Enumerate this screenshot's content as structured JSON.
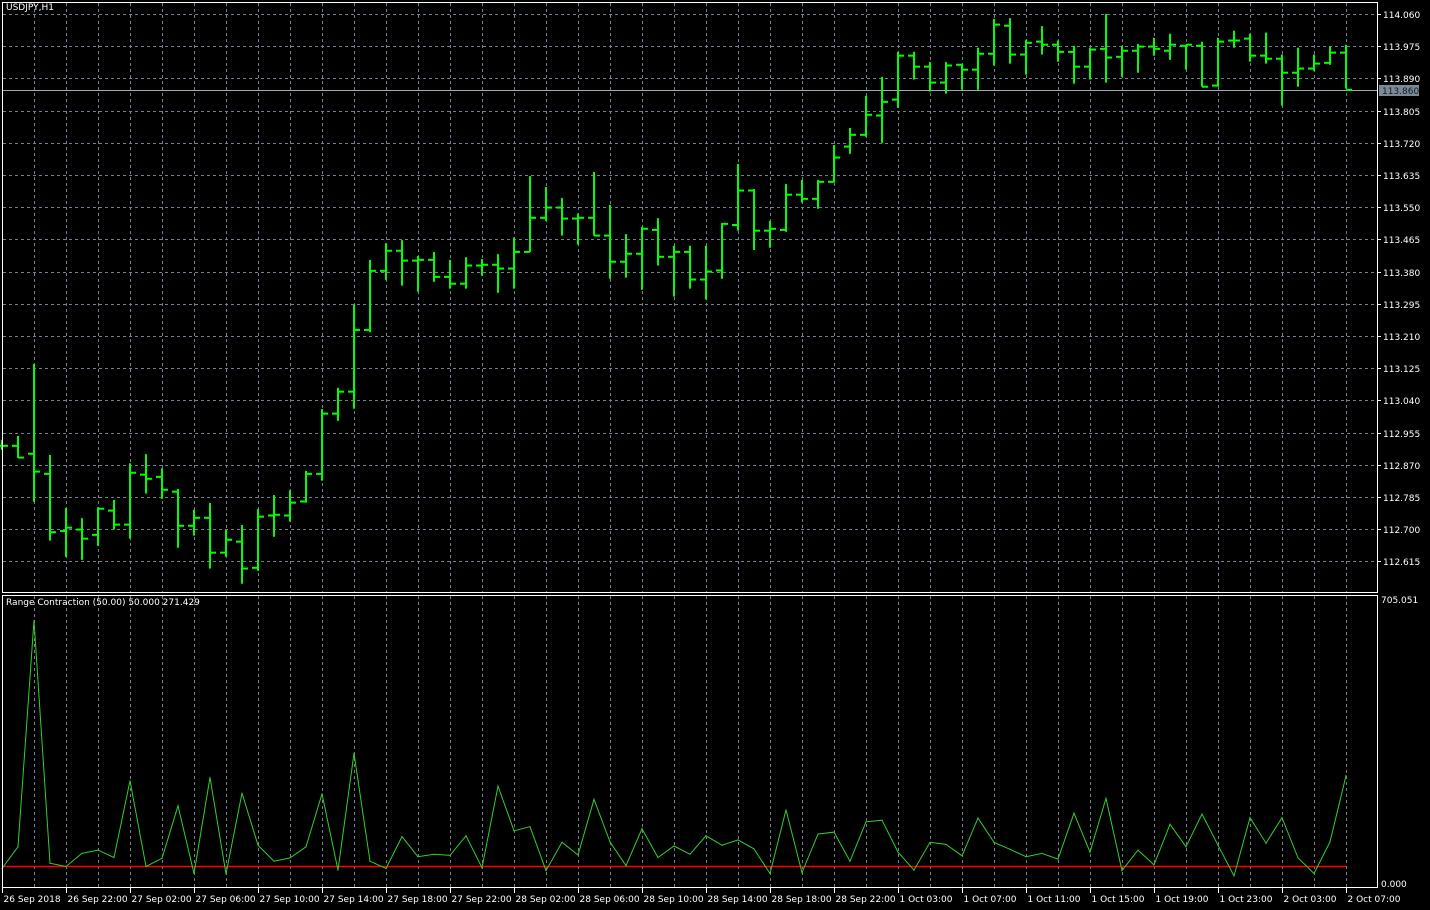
{
  "chart": {
    "title": "USDJPY,H1",
    "symbol": "USDJPY",
    "timeframe": "H1",
    "bar_color": "#00ff00",
    "grid_color": "#6f7f94",
    "current_price": "113.860",
    "price_labels": [
      "114.060",
      "113.975",
      "113.890",
      "113.805",
      "113.720",
      "113.635",
      "113.550",
      "113.465",
      "113.380",
      "113.295",
      "113.210",
      "113.125",
      "113.040",
      "112.955",
      "112.870",
      "112.785",
      "112.700",
      "112.615"
    ],
    "time_labels": [
      "26 Sep 2018",
      "26 Sep 22:00",
      "27 Sep 02:00",
      "27 Sep 06:00",
      "27 Sep 10:00",
      "27 Sep 14:00",
      "27 Sep 18:00",
      "27 Sep 22:00",
      "28 Sep 02:00",
      "28 Sep 06:00",
      "28 Sep 10:00",
      "28 Sep 14:00",
      "28 Sep 18:00",
      "28 Sep 22:00",
      "1 Oct 03:00",
      "1 Oct 07:00",
      "1 Oct 11:00",
      "1 Oct 15:00",
      "1 Oct 19:00",
      "1 Oct 23:00",
      "2 Oct 03:00",
      "2 Oct 07:00"
    ],
    "ohlc": [
      [
        112.92,
        112.935,
        112.909,
        112.92
      ],
      [
        112.92,
        112.946,
        112.888,
        112.889
      ],
      [
        112.899,
        113.136,
        112.772,
        112.852
      ],
      [
        112.846,
        112.896,
        112.67,
        112.692
      ],
      [
        112.695,
        112.756,
        112.627,
        112.704
      ],
      [
        112.699,
        112.729,
        112.619,
        112.675
      ],
      [
        112.685,
        112.758,
        112.656,
        112.754
      ],
      [
        112.749,
        112.777,
        112.699,
        112.712
      ],
      [
        112.712,
        112.874,
        112.675,
        112.849
      ],
      [
        112.844,
        112.898,
        112.794,
        112.833
      ],
      [
        112.838,
        112.861,
        112.78,
        112.804
      ],
      [
        112.799,
        112.806,
        112.651,
        112.709
      ],
      [
        112.709,
        112.751,
        112.683,
        112.73
      ],
      [
        112.73,
        112.769,
        112.596,
        112.638
      ],
      [
        112.638,
        112.698,
        112.627,
        112.672
      ],
      [
        112.667,
        112.711,
        112.556,
        112.596
      ],
      [
        112.598,
        112.753,
        112.59,
        112.733
      ],
      [
        112.736,
        112.79,
        112.68,
        112.738
      ],
      [
        112.736,
        112.803,
        112.72,
        112.77
      ],
      [
        112.773,
        112.854,
        112.77,
        112.846
      ],
      [
        112.846,
        113.017,
        112.828,
        113.005
      ],
      [
        113.005,
        113.073,
        112.986,
        113.063
      ],
      [
        113.063,
        113.292,
        113.018,
        113.226
      ],
      [
        113.226,
        113.411,
        113.22,
        113.382
      ],
      [
        113.382,
        113.455,
        113.358,
        113.435
      ],
      [
        113.435,
        113.463,
        113.343,
        113.409
      ],
      [
        113.409,
        113.421,
        113.327,
        113.411
      ],
      [
        113.411,
        113.432,
        113.353,
        113.366
      ],
      [
        113.366,
        113.411,
        113.335,
        113.348
      ],
      [
        113.348,
        113.418,
        113.335,
        113.396
      ],
      [
        113.396,
        113.413,
        113.369,
        113.398
      ],
      [
        113.398,
        113.426,
        113.324,
        113.388
      ],
      [
        113.388,
        113.47,
        113.335,
        113.432
      ],
      [
        113.432,
        113.632,
        113.432,
        113.522
      ],
      [
        113.522,
        113.603,
        113.514,
        113.549
      ],
      [
        113.549,
        113.574,
        113.475,
        113.52
      ],
      [
        113.52,
        113.533,
        113.451,
        113.522
      ],
      [
        113.522,
        113.643,
        113.475,
        113.475
      ],
      [
        113.475,
        113.556,
        113.361,
        113.406
      ],
      [
        113.406,
        113.479,
        113.364,
        113.427
      ],
      [
        113.427,
        113.498,
        113.332,
        113.493
      ],
      [
        113.49,
        113.521,
        113.396,
        113.419
      ],
      [
        113.419,
        113.448,
        113.314,
        113.432
      ],
      [
        113.432,
        113.448,
        113.335,
        113.359
      ],
      [
        113.359,
        113.448,
        113.306,
        113.38
      ],
      [
        113.383,
        113.508,
        113.361,
        113.506
      ],
      [
        113.503,
        113.664,
        113.488,
        113.594
      ],
      [
        113.594,
        113.598,
        113.437,
        113.488
      ],
      [
        113.488,
        113.514,
        113.443,
        113.493
      ],
      [
        113.49,
        113.611,
        113.485,
        113.583
      ],
      [
        113.583,
        113.622,
        113.562,
        113.572
      ],
      [
        113.572,
        113.622,
        113.546,
        113.617
      ],
      [
        113.617,
        113.714,
        113.615,
        113.681
      ],
      [
        113.71,
        113.759,
        113.691,
        113.741
      ],
      [
        113.741,
        113.844,
        113.736,
        113.794
      ],
      [
        113.792,
        113.894,
        113.72,
        113.828
      ],
      [
        113.834,
        113.96,
        113.812,
        113.95
      ],
      [
        113.95,
        113.96,
        113.887,
        113.921
      ],
      [
        113.921,
        113.933,
        113.855,
        113.879
      ],
      [
        113.879,
        113.933,
        113.85,
        113.924
      ],
      [
        113.926,
        113.929,
        113.86,
        113.913
      ],
      [
        113.913,
        113.971,
        113.86,
        113.955
      ],
      [
        113.955,
        114.047,
        113.924,
        114.032
      ],
      [
        114.029,
        114.049,
        113.929,
        113.953
      ],
      [
        113.953,
        113.992,
        113.9,
        113.984
      ],
      [
        113.987,
        114.028,
        113.953,
        113.979
      ],
      [
        113.979,
        113.99,
        113.934,
        113.96
      ],
      [
        113.96,
        113.976,
        113.876,
        113.921
      ],
      [
        113.921,
        113.971,
        113.887,
        113.966
      ],
      [
        113.968,
        114.06,
        113.879,
        113.945
      ],
      [
        113.947,
        113.976,
        113.894,
        113.963
      ],
      [
        113.963,
        113.981,
        113.905,
        113.974
      ],
      [
        113.974,
        113.997,
        113.95,
        113.968
      ],
      [
        113.963,
        114.008,
        113.939,
        113.979
      ],
      [
        113.976,
        113.979,
        113.913,
        113.979
      ],
      [
        113.976,
        113.987,
        113.868,
        113.868
      ],
      [
        113.871,
        113.997,
        113.868,
        113.987
      ],
      [
        113.99,
        114.016,
        113.971,
        113.99
      ],
      [
        113.995,
        114.008,
        113.934,
        113.95
      ],
      [
        113.95,
        114.011,
        113.929,
        113.942
      ],
      [
        113.942,
        113.953,
        113.818,
        113.905
      ],
      [
        113.905,
        113.971,
        113.868,
        113.916
      ],
      [
        113.916,
        113.953,
        113.91,
        113.929
      ],
      [
        113.931,
        113.974,
        113.926,
        113.958
      ],
      [
        113.958,
        113.979,
        113.863,
        113.86
      ]
    ]
  },
  "indicator": {
    "title": "Range Contraction (50.00) 50.000 271.429",
    "line_color": "#32cd32",
    "level_color": "#ff0000",
    "level": 50,
    "max_label": "705.051",
    "min_label": "0.000",
    "values": [
      45,
      98,
      650,
      58,
      50,
      82,
      90,
      72,
      259,
      50,
      70,
      198,
      33,
      267,
      32,
      229,
      102,
      63,
      71,
      98,
      227,
      41,
      326,
      63,
      45,
      123,
      74,
      80,
      77,
      125,
      47,
      246,
      137,
      147,
      40,
      109,
      78,
      214,
      110,
      52,
      142,
      72,
      100,
      80,
      125,
      102,
      115,
      93,
      33,
      188,
      35,
      129,
      134,
      63,
      159,
      163,
      85,
      41,
      109,
      104,
      76,
      168,
      109,
      92,
      74,
      82,
      68,
      180,
      85,
      216,
      40,
      90,
      54,
      153,
      98,
      178,
      102,
      27,
      169,
      107,
      169,
      71,
      33,
      110,
      271.429
    ]
  }
}
